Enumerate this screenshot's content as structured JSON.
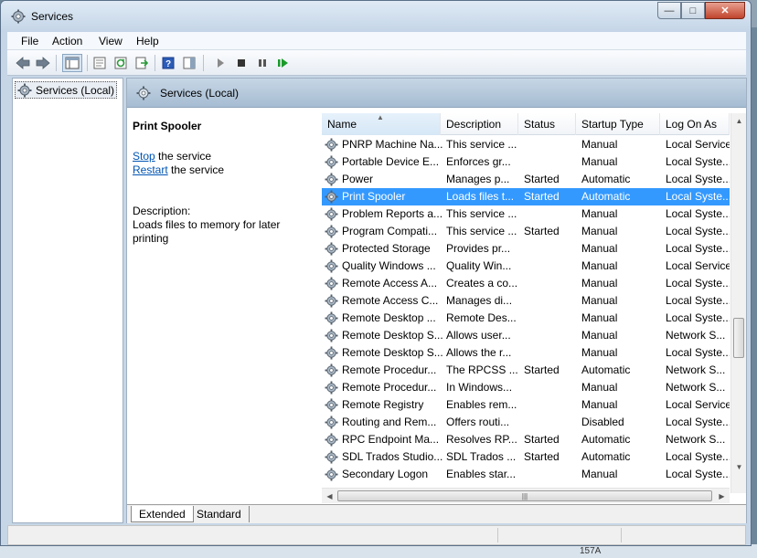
{
  "window": {
    "title": "Services"
  },
  "menu": [
    "File",
    "Action",
    "View",
    "Help"
  ],
  "toolbar": {
    "icons": [
      "back-arrow-icon",
      "forward-arrow-icon",
      "show-hide-tree-icon",
      "properties-icon",
      "refresh-icon",
      "export-list-icon",
      "help-icon",
      "show-action-pane-icon",
      "start-service-icon",
      "stop-service-icon",
      "pause-service-icon",
      "restart-service-icon"
    ]
  },
  "tree": {
    "root_label": "Services (Local)"
  },
  "content": {
    "header_title": "Services (Local)",
    "selected_service_title": "Print Spooler",
    "stop_link": "Stop",
    "stop_suffix": " the service",
    "restart_link": "Restart",
    "restart_suffix": " the service",
    "description_label": "Description:",
    "description_text": "Loads files to memory for later printing"
  },
  "columns": [
    "Name",
    "Description",
    "Status",
    "Startup Type",
    "Log On As"
  ],
  "rows": [
    {
      "name": "PNRP Machine Na...",
      "description": "This service ...",
      "status": "",
      "startup": "Manual",
      "logon": "Local Service",
      "selected": false
    },
    {
      "name": "Portable Device E...",
      "description": "Enforces gr...",
      "status": "",
      "startup": "Manual",
      "logon": "Local Syste...",
      "selected": false
    },
    {
      "name": "Power",
      "description": "Manages p...",
      "status": "Started",
      "startup": "Automatic",
      "logon": "Local Syste...",
      "selected": false
    },
    {
      "name": "Print Spooler",
      "description": "Loads files t...",
      "status": "Started",
      "startup": "Automatic",
      "logon": "Local Syste...",
      "selected": true
    },
    {
      "name": "Problem Reports a...",
      "description": "This service ...",
      "status": "",
      "startup": "Manual",
      "logon": "Local Syste...",
      "selected": false
    },
    {
      "name": "Program Compati...",
      "description": "This service ...",
      "status": "Started",
      "startup": "Manual",
      "logon": "Local Syste...",
      "selected": false
    },
    {
      "name": "Protected Storage",
      "description": "Provides pr...",
      "status": "",
      "startup": "Manual",
      "logon": "Local Syste...",
      "selected": false
    },
    {
      "name": "Quality Windows ...",
      "description": "Quality Win...",
      "status": "",
      "startup": "Manual",
      "logon": "Local Service",
      "selected": false
    },
    {
      "name": "Remote Access A...",
      "description": "Creates a co...",
      "status": "",
      "startup": "Manual",
      "logon": "Local Syste...",
      "selected": false
    },
    {
      "name": "Remote Access C...",
      "description": "Manages di...",
      "status": "",
      "startup": "Manual",
      "logon": "Local Syste...",
      "selected": false
    },
    {
      "name": "Remote Desktop ...",
      "description": "Remote Des...",
      "status": "",
      "startup": "Manual",
      "logon": "Local Syste...",
      "selected": false
    },
    {
      "name": "Remote Desktop S...",
      "description": "Allows user...",
      "status": "",
      "startup": "Manual",
      "logon": "Network S...",
      "selected": false
    },
    {
      "name": "Remote Desktop S...",
      "description": "Allows the r...",
      "status": "",
      "startup": "Manual",
      "logon": "Local Syste...",
      "selected": false
    },
    {
      "name": "Remote Procedur...",
      "description": "The RPCSS ...",
      "status": "Started",
      "startup": "Automatic",
      "logon": "Network S...",
      "selected": false
    },
    {
      "name": "Remote Procedur...",
      "description": "In Windows...",
      "status": "",
      "startup": "Manual",
      "logon": "Network S...",
      "selected": false
    },
    {
      "name": "Remote Registry",
      "description": "Enables rem...",
      "status": "",
      "startup": "Manual",
      "logon": "Local Service",
      "selected": false
    },
    {
      "name": "Routing and Rem...",
      "description": "Offers routi...",
      "status": "",
      "startup": "Disabled",
      "logon": "Local Syste...",
      "selected": false
    },
    {
      "name": "RPC Endpoint Ma...",
      "description": "Resolves RP...",
      "status": "Started",
      "startup": "Automatic",
      "logon": "Network S...",
      "selected": false
    },
    {
      "name": "SDL Trados Studio...",
      "description": "SDL Trados ...",
      "status": "Started",
      "startup": "Automatic",
      "logon": "Local Syste...",
      "selected": false
    },
    {
      "name": "Secondary Logon",
      "description": "Enables star...",
      "status": "",
      "startup": "Manual",
      "logon": "Local Syste...",
      "selected": false
    }
  ],
  "tabs": [
    "Extended",
    "Standard"
  ],
  "background": {
    "bottom_text": "157A"
  },
  "colors": {
    "selection": "#3399ff",
    "link": "#0054b4",
    "play_green": "#1a9a2a"
  }
}
